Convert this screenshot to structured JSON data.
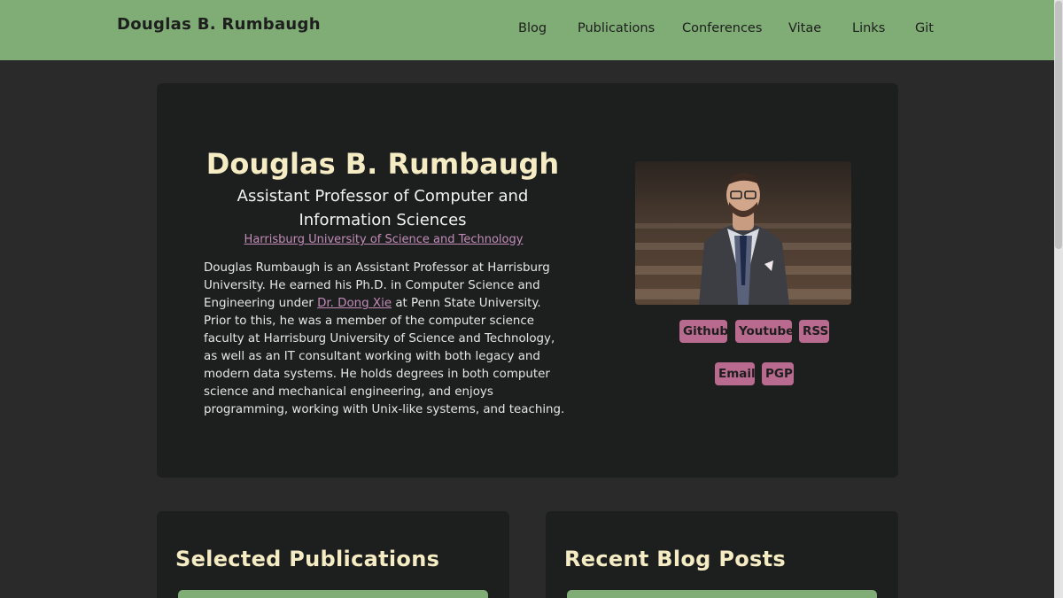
{
  "header": {
    "site_title": "Douglas B. Rumbaugh",
    "nav": [
      "Blog",
      "Publications",
      "Conferences",
      "Vitae",
      "Links",
      "Git"
    ]
  },
  "hero": {
    "name": "Douglas B. Rumbaugh",
    "role": "Assistant Professor of Computer and Information Sciences",
    "affiliation": "Harrisburg University of Science and Technology",
    "bio_before_link": "Douglas Rumbaugh is an Assistant Professor at Harrisburg University. He earned his Ph.D. in Computer Science and Engineering under ",
    "bio_link": "Dr. Dong Xie",
    "bio_after_link": " at Penn State University. Prior to this, he was a member of the computer science faculty at Harrisburg University of Science and Technology, as well as an IT consultant working with both legacy and modern data systems. He holds degrees in both computer science and mechanical engineering, and enjoys programming, working with Unix-like systems, and teaching."
  },
  "social_links": [
    "Github",
    "Youtube",
    "RSS",
    "Email",
    "PGP"
  ],
  "sections": {
    "publications_title": "Selected Publications",
    "blog_title": "Recent Blog Posts"
  },
  "colors": {
    "header_bg": "#7fad75",
    "page_bg": "#2a2a2a",
    "card_bg": "#1d1f1f",
    "heading": "#f6ecc4",
    "link": "#c28bb8",
    "badge": "#b96a8f"
  }
}
